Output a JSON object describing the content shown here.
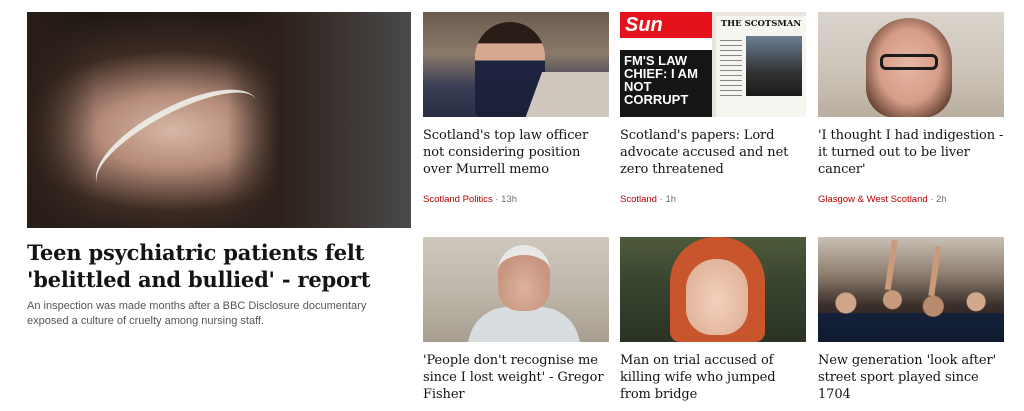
{
  "lead": {
    "title": "Teen psychiatric patients felt 'belittled and bullied' - report",
    "summary": "An inspection was made months after a BBC Disclosure documentary exposed a culture of cruelty among nursing staff."
  },
  "cards": [
    {
      "title": "Scotland's top law officer not considering position over Murrell memo",
      "tag": "Scotland Politics",
      "sep": "·",
      "time": "13h"
    },
    {
      "title": "Scotland's papers: Lord advocate accused and net zero threatened",
      "tag": "Scotland",
      "sep": "·",
      "time": "1h",
      "image_text": {
        "sun_masthead": "Sun",
        "sun_headline": "FM'S LAW CHIEF: I AM NOT CORRUPT",
        "scotsman_masthead": "THE SCOTSMAN"
      }
    },
    {
      "title": "'I thought I had indigestion - it turned out to be liver cancer'",
      "tag": "Glasgow & West Scotland",
      "sep": "·",
      "time": "2h"
    },
    {
      "title": "'People don't recognise me since I lost weight' - Gregor Fisher"
    },
    {
      "title": "Man on trial accused of killing wife who jumped from bridge"
    },
    {
      "title": "New generation 'look after' street sport played since 1704"
    }
  ],
  "colors": {
    "tag": "#b80000",
    "meta": "#6e6e73",
    "text": "#141414"
  }
}
